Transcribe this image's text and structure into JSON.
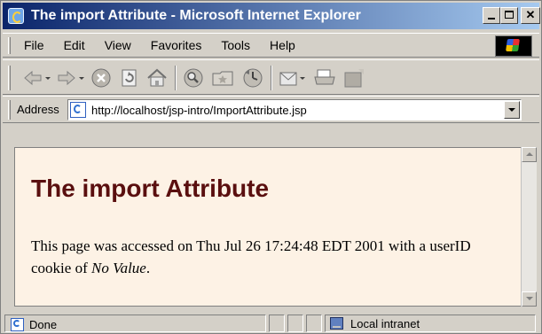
{
  "window": {
    "title": "The import Attribute - Microsoft Internet Explorer"
  },
  "menu": {
    "items": [
      "File",
      "Edit",
      "View",
      "Favorites",
      "Tools",
      "Help"
    ]
  },
  "toolbar": {
    "icons": [
      "back-icon",
      "forward-icon",
      "stop-icon",
      "refresh-icon",
      "home-icon",
      "search-icon",
      "favorites-icon",
      "history-icon",
      "mail-icon",
      "print-icon",
      "edit-icon"
    ]
  },
  "address": {
    "label": "Address",
    "url": "http://localhost/jsp-intro/ImportAttribute.jsp"
  },
  "page": {
    "heading": "The import Attribute",
    "text_before": "This page was accessed on Thu Jul 26 17:24:48 EDT 2001 with a userID cookie of ",
    "cookie_value": "No Value",
    "text_after": "."
  },
  "status": {
    "text": "Done",
    "zone": "Local intranet"
  },
  "colors": {
    "titlebar_start": "#0a246a",
    "titlebar_end": "#a6caf0",
    "page_bg": "#fdf2e5",
    "heading": "#5a0f0f"
  }
}
